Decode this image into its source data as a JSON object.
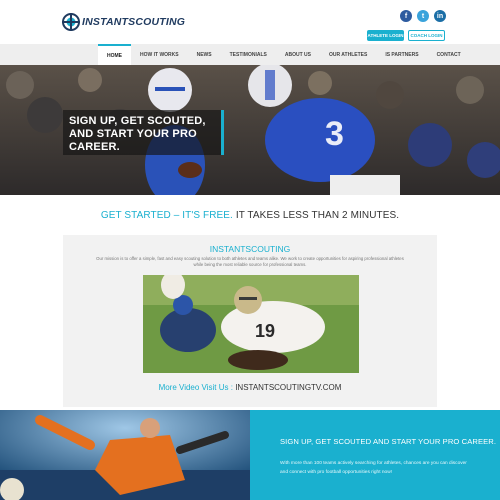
{
  "header": {
    "logo_text": "INSTANTSCOUTING",
    "socials": [
      {
        "icon": "facebook-icon",
        "glyph": "f"
      },
      {
        "icon": "twitter-icon",
        "glyph": "t"
      },
      {
        "icon": "linkedin-icon",
        "glyph": "in"
      }
    ],
    "athlete_login": "ATHLETE LOGIN",
    "coach_login": "COACH LOGIN"
  },
  "nav": {
    "items": [
      "HOME",
      "HOW IT WORKS",
      "NEWS",
      "TESTIMONIALS",
      "ABOUT US",
      "OUR ATHLETES",
      "IS PARTNERS",
      "CONTACT"
    ],
    "active": "HOME"
  },
  "hero": {
    "lines": [
      "SIGN UP, GET SCOUTED,",
      "AND START YOUR PRO CAREER."
    ]
  },
  "get_started": {
    "highlight": "GET STARTED – IT'S FREE.",
    "rest": " IT TAKES LESS THAN 2 MINUTES."
  },
  "content": {
    "title": "INSTANTSCOUTING",
    "mission": "Our mission is to offer a simple, fast and easy scouting solution to both athletes and teams alike. We work to create opportunities for aspiring professional athletes while being the most reliable source for professional teams.",
    "more_video_label": "More Video Visit Us :",
    "more_video_link": " INSTANTSCOUTINGTV.COM"
  },
  "bottom": {
    "cta_title": "SIGN UP, GET SCOUTED AND START YOUR PRO CAREER.",
    "cta_text": "With more than 100 teams actively searching for athletes, chances are you can discover and connect with pro football opportunities right now!"
  },
  "colors": {
    "accent": "#1ab0cf",
    "brand_dark": "#1f3a5f"
  }
}
